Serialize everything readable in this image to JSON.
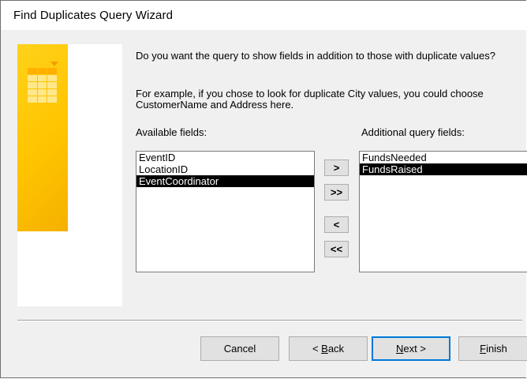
{
  "window": {
    "title": "Find Duplicates Query Wizard"
  },
  "instructions": {
    "question": "Do you want the query to show fields in addition to those with duplicate values?",
    "example_line1": "For example, if you chose to look for duplicate City values, you could choose",
    "example_line2": "CustomerName and Address here."
  },
  "available": {
    "label": "Available fields:",
    "items": [
      {
        "label": "EventID",
        "selected": false
      },
      {
        "label": "LocationID",
        "selected": false
      },
      {
        "label": "EventCoordinator",
        "selected": true
      }
    ]
  },
  "additional": {
    "label": "Additional query fields:",
    "items": [
      {
        "label": "FundsNeeded",
        "selected": false
      },
      {
        "label": "FundsRaised",
        "selected": true
      }
    ]
  },
  "move_buttons": {
    "add_one": ">",
    "add_all": ">>",
    "remove_one": "<",
    "remove_all": "<<"
  },
  "footer": {
    "cancel": "Cancel",
    "back_prefix": "< ",
    "back_mnemonic": "B",
    "back_rest": "ack",
    "next_mnemonic": "N",
    "next_rest": "ext >",
    "finish_mnemonic": "F",
    "finish_rest": "inish"
  },
  "colors": {
    "accent": "#0078d7",
    "selection": "#000000",
    "art_yellow": "#ffc400"
  }
}
